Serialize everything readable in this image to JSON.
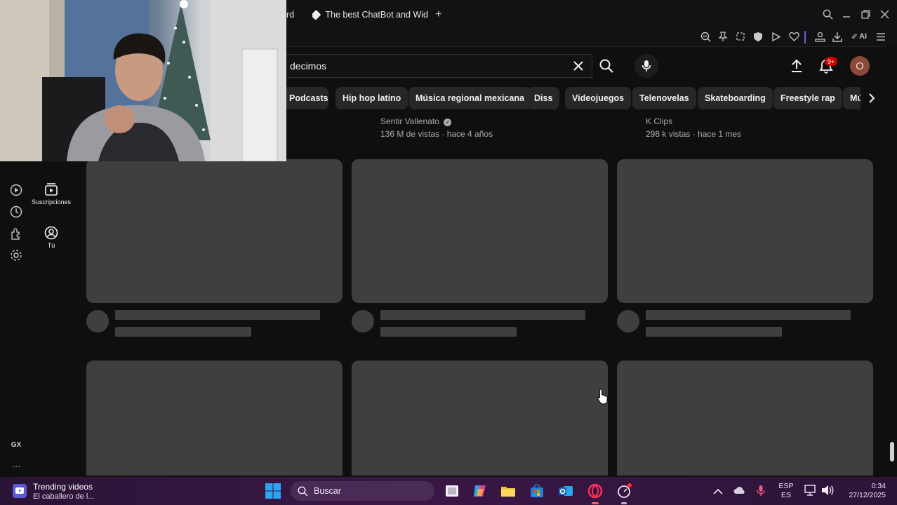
{
  "browser": {
    "tabs": [
      {
        "label": "rd"
      },
      {
        "label": "The best ChatBot and Wid"
      }
    ],
    "new_tab": "+",
    "toolbar_ai": "AI"
  },
  "youtube": {
    "search": {
      "query": "decimos"
    },
    "notifications_badge": "9+",
    "avatar_initial": "O",
    "chips": [
      "Podcasts",
      "Hip hop latino",
      "Música regional mexicana",
      "Diss",
      "Videojuegos",
      "Telenovelas",
      "Skateboarding",
      "Freestyle rap",
      "Mú"
    ],
    "videos_top": [
      {
        "channel": "Sentir Vallenato",
        "verified": true,
        "stats": "136 M de vistas · hace 4 años"
      },
      {
        "channel": "K Clips",
        "verified": false,
        "stats": "298 k vistas · hace 1 mes"
      }
    ],
    "mini_guide": [
      {
        "label": "Suscripciones",
        "icon": "subscriptions-icon"
      },
      {
        "label": "Tú",
        "icon": "you-icon"
      }
    ]
  },
  "opera_sidebar": {
    "gx_label": "GX",
    "more": "···"
  },
  "taskbar": {
    "widget_title": "Trending videos",
    "widget_subtitle": "El caballero de l...",
    "search_placeholder": "Buscar",
    "lang_top": "ESP",
    "lang_bottom": "ES",
    "time": "0:34",
    "date": "27/12/2025"
  }
}
